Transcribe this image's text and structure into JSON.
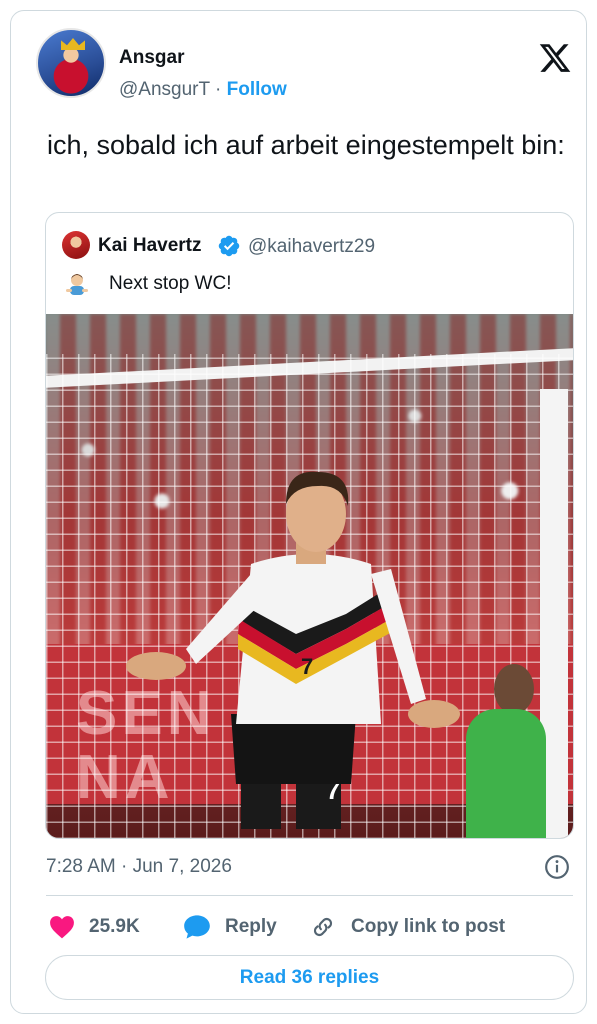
{
  "author": {
    "name": "Ansgar",
    "handle": "@AnsgurT",
    "separator": "·",
    "follow_label": "Follow"
  },
  "tweet": {
    "text": "ich, sobald ich auf arbeit eingestempelt bin:"
  },
  "quoted": {
    "name": "Kai Havertz",
    "handle": "@kaihavertz29",
    "text": "Next stop WC!",
    "photo_banner_text": "SEN\nNA"
  },
  "meta": {
    "timestamp": "7:28 AM · Jun 7, 2026"
  },
  "actions": {
    "likes": "25.9K",
    "reply_label": "Reply",
    "copy_label": "Copy link to post"
  },
  "footer": {
    "read_replies_label": "Read 36 replies"
  },
  "colors": {
    "accent": "#1d9bf0",
    "like": "#f91880",
    "text": "#0f1419",
    "muted": "#536471",
    "border": "#cfd9de"
  },
  "icons": {
    "x_logo": "x-logo-icon",
    "verified": "verified-badge-icon",
    "info": "info-icon",
    "like": "heart-icon",
    "reply": "speech-bubble-icon",
    "copy": "link-icon"
  }
}
